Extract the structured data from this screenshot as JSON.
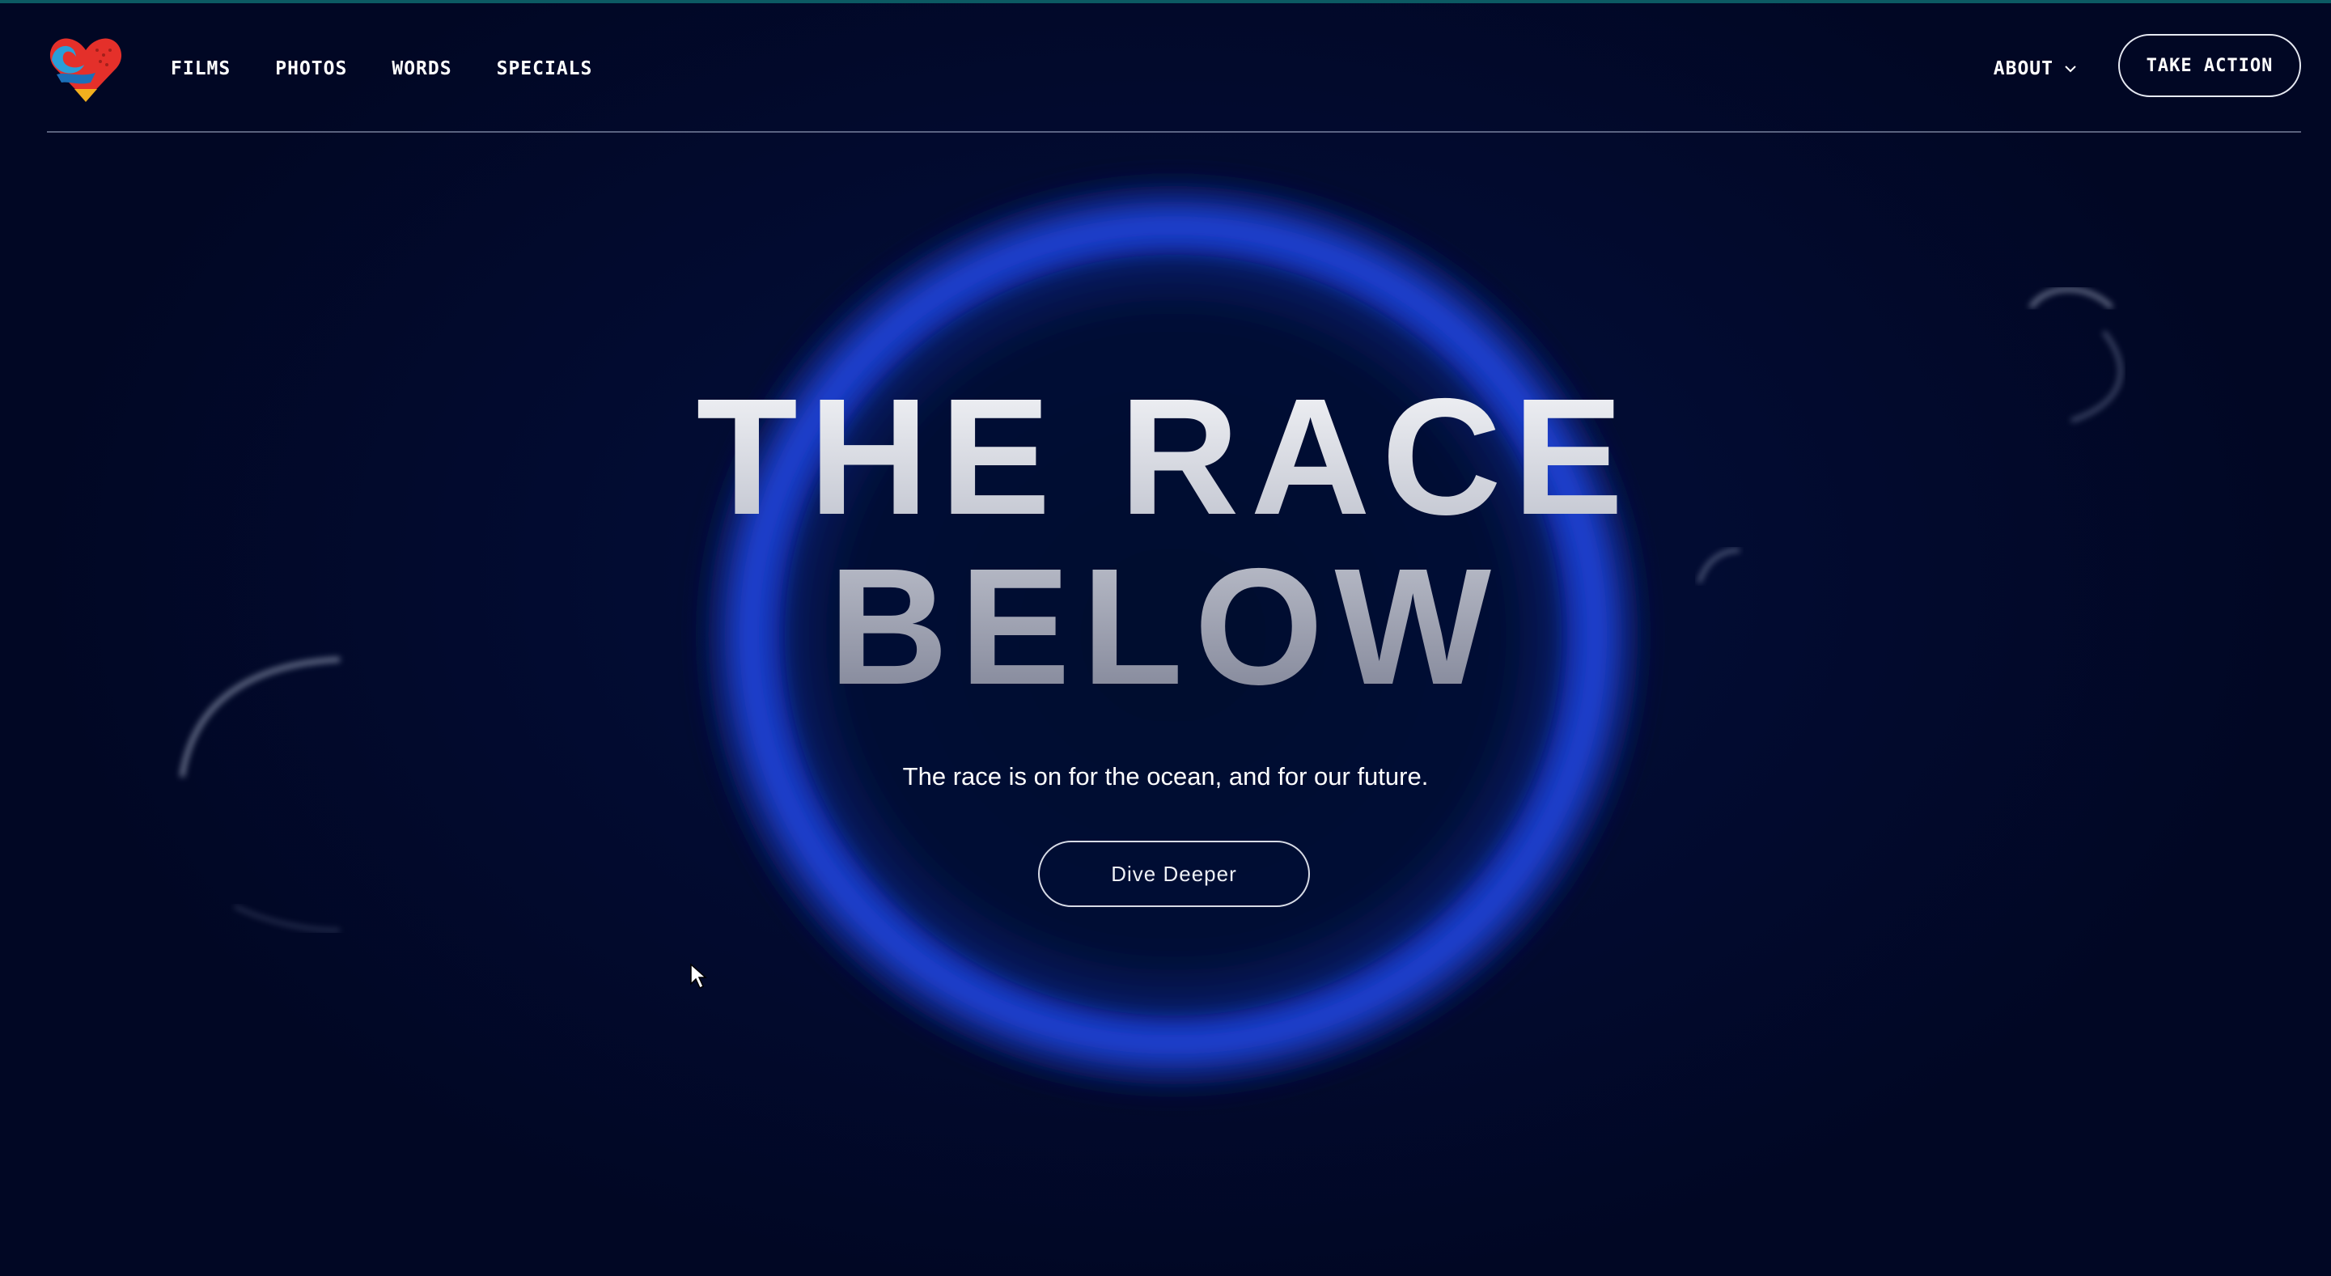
{
  "header": {
    "logo": "heart-wave-logo",
    "nav": [
      {
        "label": "FILMS"
      },
      {
        "label": "PHOTOS"
      },
      {
        "label": "WORDS"
      },
      {
        "label": "SPECIALS"
      }
    ],
    "about_label": "ABOUT",
    "take_action_label": "TAKE ACTION"
  },
  "hero": {
    "title_line1": "THE RACE",
    "title_line2": "BELOW",
    "subtitle": "The race is on for the ocean, and for our future.",
    "cta_label": "Dive Deeper"
  },
  "colors": {
    "background": "#020a2a",
    "ring": "#1e3fd6",
    "text": "#ffffff"
  }
}
